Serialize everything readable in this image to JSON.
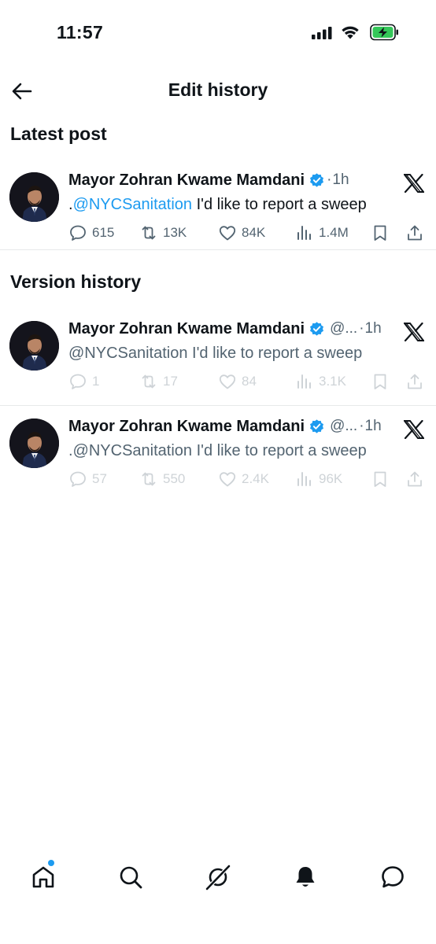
{
  "status_bar": {
    "time": "11:57",
    "icons": [
      "signal-icon",
      "wifi-icon",
      "battery-charging-icon"
    ],
    "battery_color": "#34c759"
  },
  "header": {
    "title": "Edit history",
    "back_icon": "arrow-left-icon"
  },
  "sections": {
    "latest": "Latest post",
    "versions": "Version history"
  },
  "colors": {
    "accent": "#1d9bf0",
    "text": "#0f1419",
    "secondary": "#536471",
    "divider": "#e7e9ea"
  },
  "latest_post": {
    "author": "Mayor Zohran Kwame Mamdani",
    "verified": true,
    "dot": "·",
    "time": "1h",
    "text_prefix": ".",
    "mention": "@NYCSanitation",
    "text_rest": " I'd like to report a sweep",
    "stats": {
      "replies": "615",
      "reposts": "13K",
      "likes": "84K",
      "views": "1.4M"
    }
  },
  "versions": [
    {
      "author": "Mayor Zohran Kwame Mamdani",
      "verified": true,
      "handle": "@...",
      "dot": "·",
      "time": "1h",
      "text": "@NYCSanitation I'd like to report a sweep",
      "stats": {
        "replies": "1",
        "reposts": "17",
        "likes": "84",
        "views": "3.1K"
      }
    },
    {
      "author": "Mayor Zohran Kwame Mamdani",
      "verified": true,
      "handle": "@...",
      "dot": "·",
      "time": "1h",
      "text": ".@NYCSanitation I'd like to report a sweep",
      "stats": {
        "replies": "57",
        "reposts": "550",
        "likes": "2.4K",
        "views": "96K"
      }
    }
  ],
  "bottom_nav": {
    "items": [
      "home-icon",
      "search-icon",
      "grok-icon",
      "notifications-icon",
      "messages-icon"
    ],
    "home_has_notification": true
  }
}
